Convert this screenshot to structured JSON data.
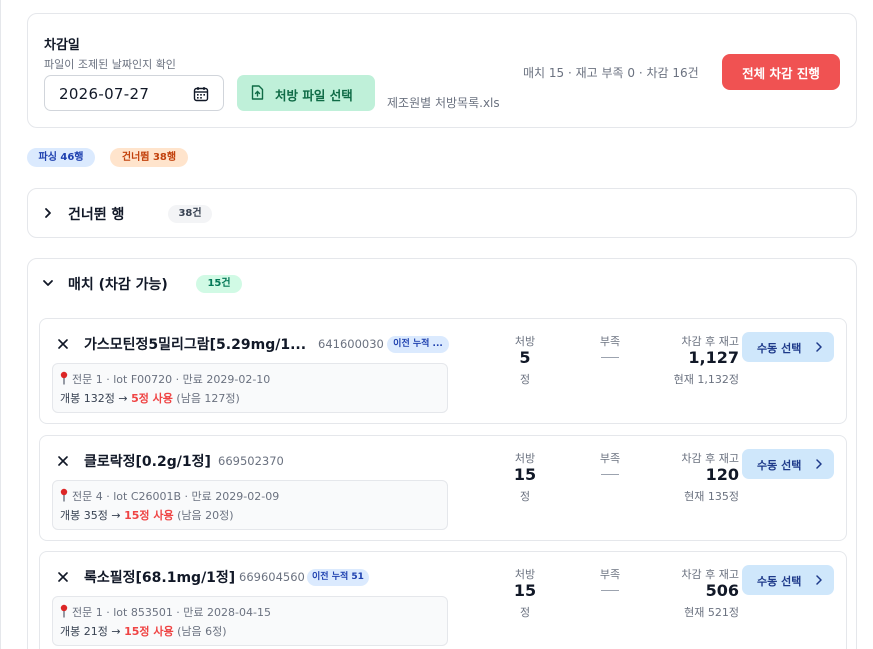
{
  "header": {
    "title": "차감일",
    "subtitle": "파일이 조제된 날짜인지 확인",
    "date_value": "2026-07-27",
    "file_button": "처방 파일 선택",
    "file_name": "제조원별 처방목록.xls",
    "summary": "매치 15 · 재고 부족 0 · 차감 16건",
    "run_button": "전체 차감 진행",
    "colors": {
      "run": "#f05252",
      "file": "#bff0d9"
    }
  },
  "badges": {
    "parsed": "파싱 46행",
    "skipped": "건너뜀 38행"
  },
  "skipped_section": {
    "title": "건너뛴 행",
    "count": "38건",
    "icon": "chevron-right-icon"
  },
  "match_section": {
    "title": "매치 (차감 가능)",
    "count": "15건",
    "icon": "chevron-down-icon",
    "column_labels": {
      "rx": "처방",
      "short": "부족",
      "after": "차감 후 재고"
    },
    "manual_label": "수동 선택",
    "items": [
      {
        "name": "가스모틴정5밀리그람[5.29mg/1...",
        "code": "641600030",
        "tag": "이전 누적 ...",
        "lot_line": "전문 1 · lot F00720 · 만료 2029-02-10",
        "use_prefix": "개봉 132정 → ",
        "use_red": "5정 사용",
        "use_rest": " (남음 127정)",
        "rx_qty": "5",
        "rx_unit": "정",
        "after_stock": "1,127",
        "current": "현재 1,132정"
      },
      {
        "name": "클로락정[0.2g/1정]",
        "code": "669502370",
        "tag": "",
        "lot_line": "전문 4 · lot C26001B · 만료 2029-02-09",
        "use_prefix": "개봉 35정 → ",
        "use_red": "15정 사용",
        "use_rest": " (남음 20정)",
        "rx_qty": "15",
        "rx_unit": "정",
        "after_stock": "120",
        "current": "현재 135정"
      },
      {
        "name": "록소필정[68.1mg/1정]",
        "code": "669604560",
        "tag": "이전 누적 51",
        "lot_line": "전문 1 · lot 853501 · 만료 2028-04-15",
        "use_prefix": "개봉 21정 → ",
        "use_red": "15정 사용",
        "use_rest": " (남음 6정)",
        "rx_qty": "15",
        "rx_unit": "정",
        "after_stock": "506",
        "current": "현재 521정"
      }
    ]
  }
}
